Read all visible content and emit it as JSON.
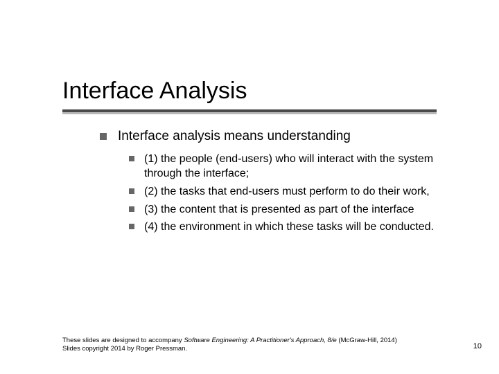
{
  "title": "Interface Analysis",
  "main_item": "Interface analysis means understanding",
  "sub_items": [
    "(1) the people (end-users) who will interact with the system through the interface;",
    "(2) the tasks that end-users must perform to do their work,",
    "(3) the content that is presented as part of the interface",
    " (4) the environment in which these tasks will be conducted."
  ],
  "footer": {
    "lead": "These slides are designed to accompany ",
    "source": "Software Engineering: A Practitioner's Approach, 8/e",
    "tail": " (McGraw-Hill, 2014) Slides copyright 2014 by Roger Pressman."
  },
  "page_number": "10"
}
